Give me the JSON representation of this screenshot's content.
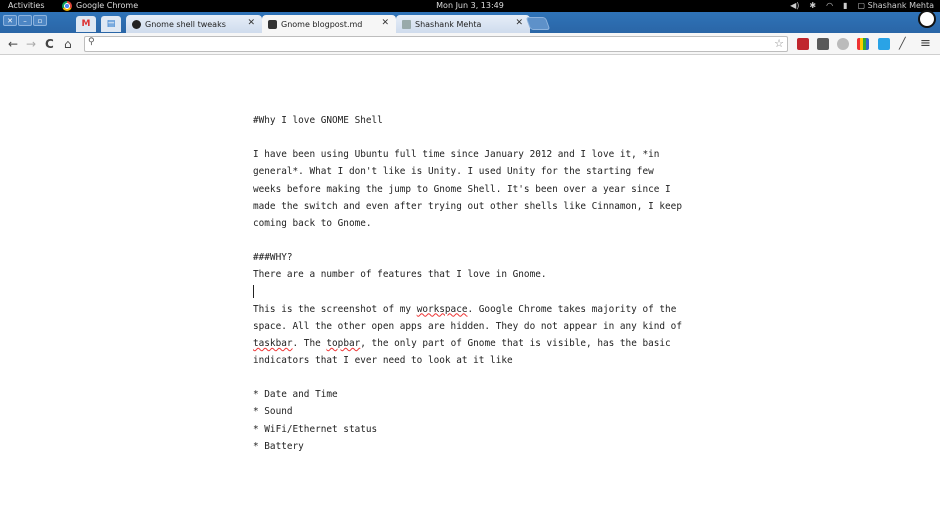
{
  "topbar": {
    "activities": "Activities",
    "app_name": "Google Chrome",
    "clock": "Mon Jun  3, 13:49",
    "user": "Shashank Mehta"
  },
  "tabs": [
    {
      "label": "Gnome shell tweaks",
      "favicon": "github-icon"
    },
    {
      "label": "Gnome blogpost.md",
      "favicon": "document-icon",
      "active": true
    },
    {
      "label": "Shashank Mehta",
      "favicon": "bookmark-icon"
    }
  ],
  "pinned": [
    {
      "icon": "gmail-icon",
      "glyph": "M"
    },
    {
      "icon": "calendar-icon",
      "glyph": "▤"
    }
  ],
  "toolbar": {
    "back": "←",
    "forward": "→",
    "reload": "C",
    "home": "⌂",
    "url": "",
    "search_glyph": "⚲",
    "star": "☆",
    "menu": "≡"
  },
  "document": {
    "heading": "#Why I love GNOME Shell",
    "p1": [
      "I have been using Ubuntu full time since January 2012 and I love it, *in",
      "general*. What I don't like is Unity. I used Unity for the starting few",
      "weeks before making the jump to Gnome Shell. It's been over a year since I",
      "made the switch and even after trying out other shells like Cinnamon, I keep",
      "coming back to Gnome."
    ],
    "why_heading": "###WHY?",
    "why_line": "There are a number of features that I love in Gnome.",
    "p2": {
      "l1_a": "This is the screenshot of my ",
      "l1_b": "workspace",
      "l1_c": ". Google Chrome takes majority of the",
      "l2": "space. All the other open apps are hidden. They do not appear in any kind of",
      "l3_a": "",
      "l3_b": "taskbar",
      "l3_c": ". The ",
      "l3_d": "topbar",
      "l3_e": ", the only part of Gnome that is visible, has the basic",
      "l4": "indicators that I ever need to look at it like"
    },
    "list": [
      "* Date and Time",
      "* Sound",
      "* WiFi/Ethernet status",
      "* Battery"
    ]
  },
  "colors": {
    "tabstrip": "#2f73b8",
    "topbar": "#000000",
    "spellcheck": "#ee3333"
  }
}
